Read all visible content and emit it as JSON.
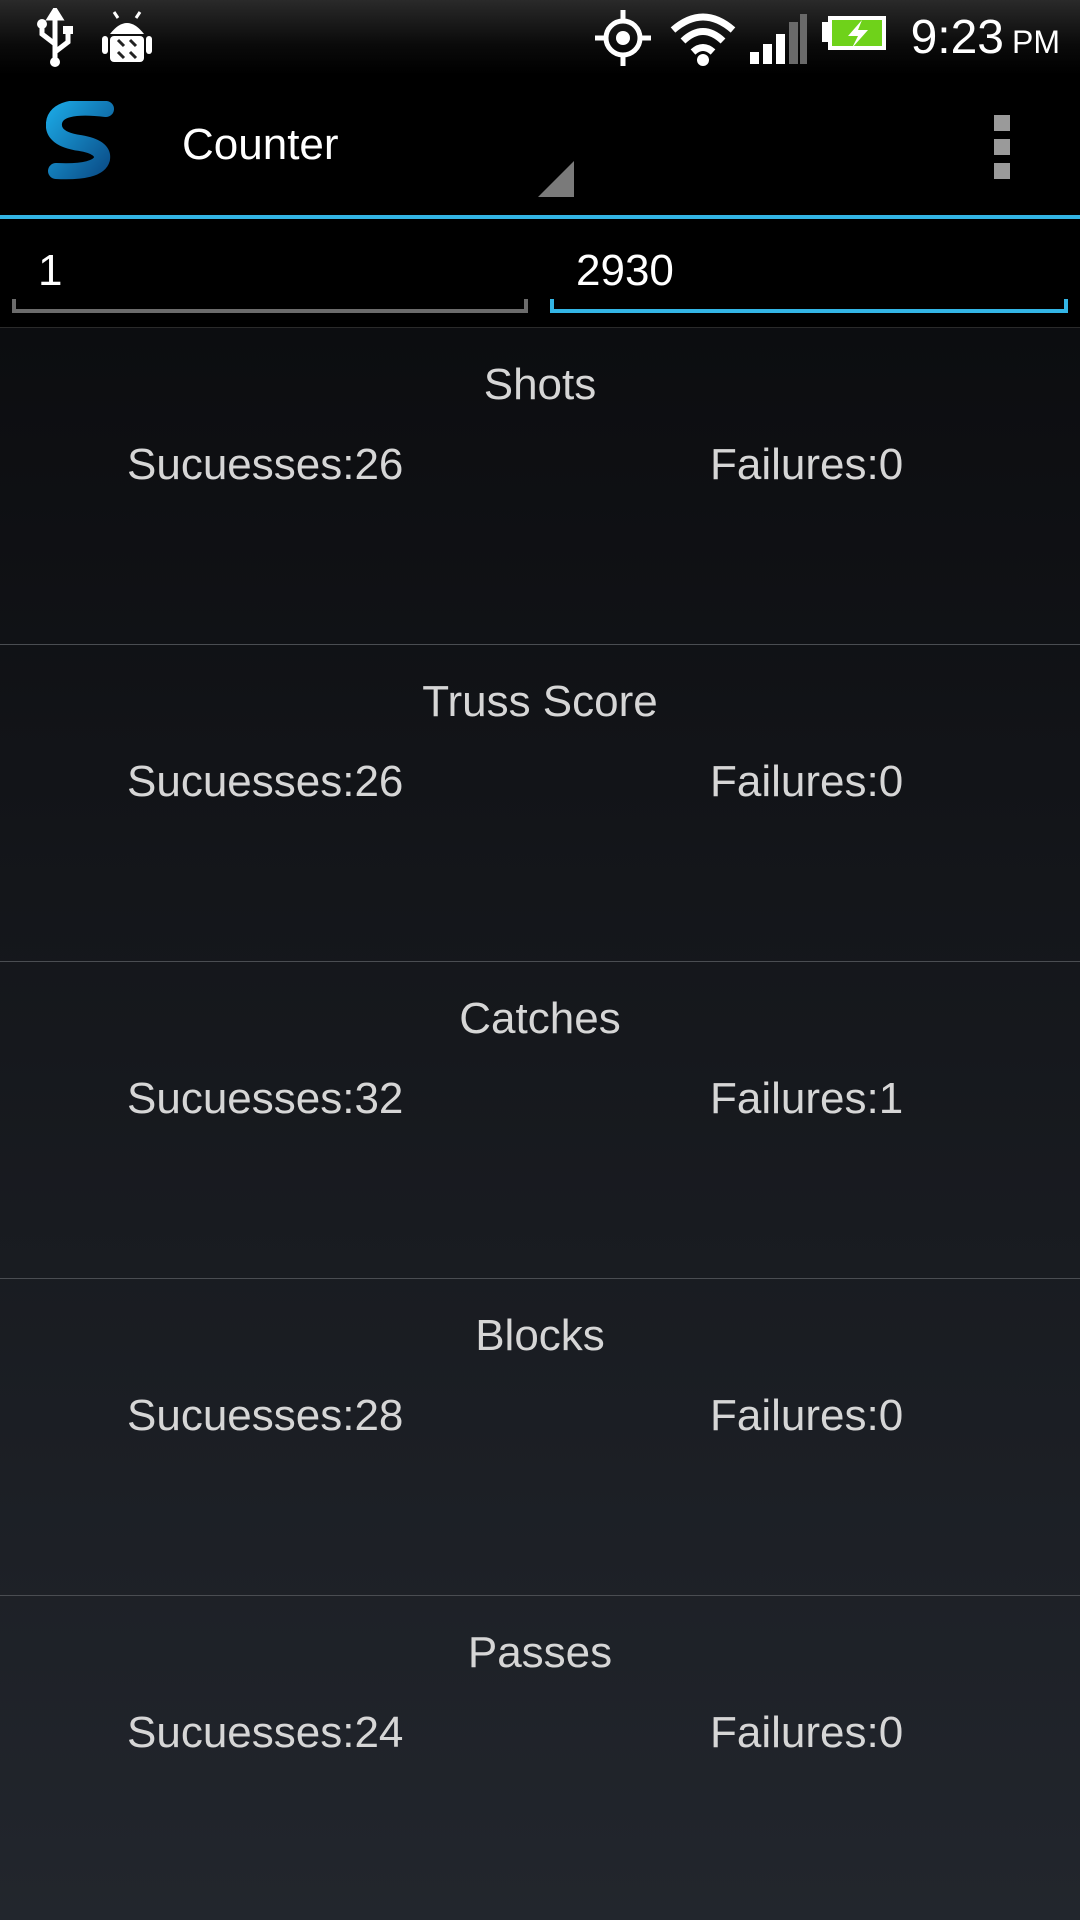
{
  "status_bar": {
    "time": "9:23",
    "ampm": "PM",
    "icons": [
      "usb-icon",
      "android-debug-icon",
      "gps-icon",
      "wifi-icon",
      "signal-icon",
      "battery-charging-icon"
    ]
  },
  "action_bar": {
    "title": "Counter",
    "logo": "app-logo-s",
    "menu_icon": "overflow-menu-icon"
  },
  "inputs": {
    "team_value": "1",
    "match_value": "2930"
  },
  "stats": [
    {
      "title": "Shots",
      "successes": "Sucuesses:26",
      "failures": "Failures:0"
    },
    {
      "title": "Truss Score",
      "successes": "Sucuesses:26",
      "failures": "Failures:0"
    },
    {
      "title": "Catches",
      "successes": "Sucuesses:32",
      "failures": "Failures:1"
    },
    {
      "title": "Blocks",
      "successes": "Sucuesses:28",
      "failures": "Failures:0"
    },
    {
      "title": "Passes",
      "successes": "Sucuesses:24",
      "failures": "Failures:0"
    }
  ],
  "colors": {
    "accent": "#33b5e5",
    "battery": "#6fd21a"
  }
}
